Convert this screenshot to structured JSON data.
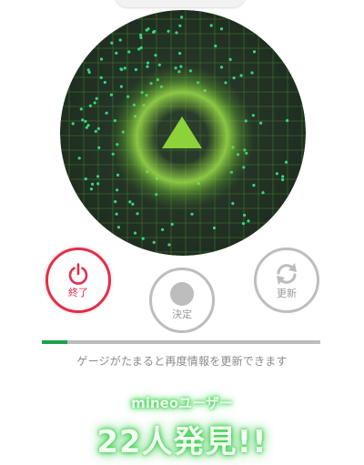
{
  "controls": {
    "stop_label": "終了",
    "decide_label": "決定",
    "refresh_label": "更新"
  },
  "gauge": {
    "progress": 0.09,
    "hint": "ゲージがたまると再度情報を更新できます"
  },
  "result": {
    "users_label": "mineoユーザー",
    "found_text": "22人発見!!"
  },
  "colors": {
    "accent_green": "#19a34a",
    "stop_red": "#e0304a",
    "radar_bg": "#263628",
    "arrow_green": "#8ed23a",
    "dot_green": "#36d67e"
  },
  "radar": {
    "arrow_icon": "navigation-arrow-icon",
    "user_dot_count": 120
  }
}
